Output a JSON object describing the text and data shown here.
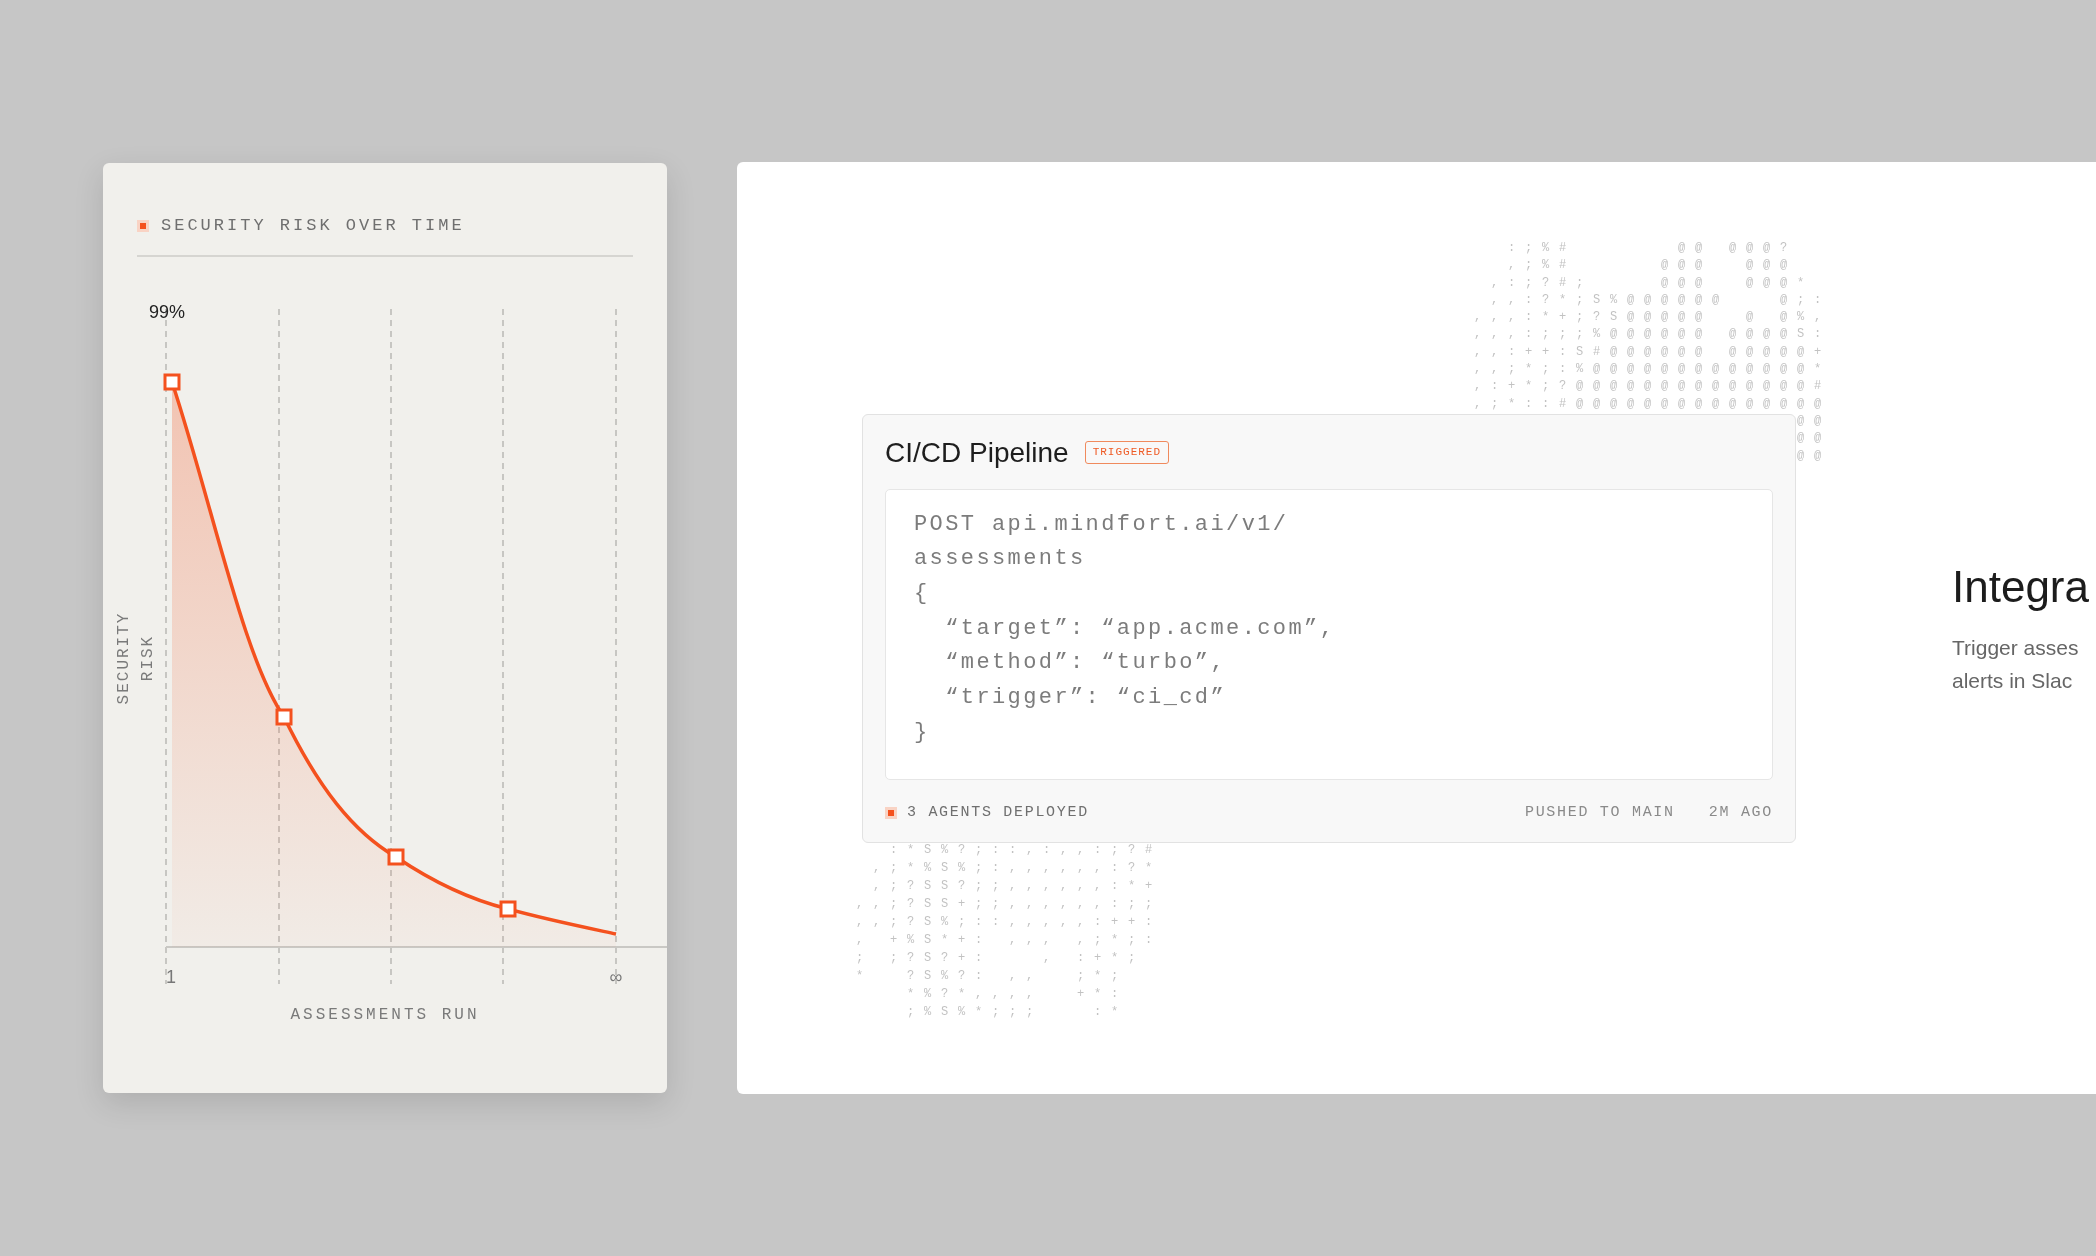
{
  "risk_card": {
    "title": "SECURITY RISK OVER TIME",
    "y_tick": "99%",
    "y_label": "SECURITY RISK",
    "x_ticks": [
      "1",
      "∞"
    ],
    "x_label": "ASSESSMENTS RUN"
  },
  "ascii_art_top": [
    "  :;%#      @@ @@@?",
    "  ,;%#     @@@  @@@",
    " ,:;?#;    @@@  @@@*",
    " ,,:?*;S%@@@@@@   @;:",
    ",,,:*+;?S@@@@@  @ @%,",
    ",,,:;;;%@@@@@@ @@@@S:",
    ",,:++:S#@@@@@@ @@@@@+",
    ",,;*;:%@@@@@@@@@@@@@*",
    ",:+*;?@@@@@@@@@@@@@@#",
    ",;*::#@@@@@@@@@@@@@@@",
    "                   @@",
    "                   @@",
    "                   @@"
  ],
  "pipeline_card": {
    "title": "CI/CD Pipeline",
    "badge": "TRIGGERED",
    "code_lines": [
      "POST api.mindfort.ai/v1/",
      "assessments",
      "{",
      "  “target”: “app.acme.com”,",
      "  “method”: “turbo”,",
      "  “trigger”: “ci_cd”",
      "}"
    ],
    "status": "3 AGENTS DEPLOYED",
    "meta": [
      "PUSHED TO MAIN",
      "2M AGO"
    ]
  },
  "ascii_art_bottom": [
    "  :*S%?;::,:,,:;?#",
    " ,;*%S%;:,,,,,,:?*",
    " ,;?SS?;;,,,,,,:*+",
    ",,;?SS+;;,,,,,,:;;",
    ",,;?S%;::,,,,,:++:",
    ", +%S*+: ,,, ,;*;:",
    "; ;?S?+:   , :+*;",
    "*  ?S%?: ,,  ;*;",
    "   *%?*,,,,  +*:",
    "   ;%S%*;;;   :*"
  ],
  "integration": {
    "heading": "Integra",
    "description_lines": [
      "Trigger asses",
      "alerts in Slac"
    ]
  }
}
